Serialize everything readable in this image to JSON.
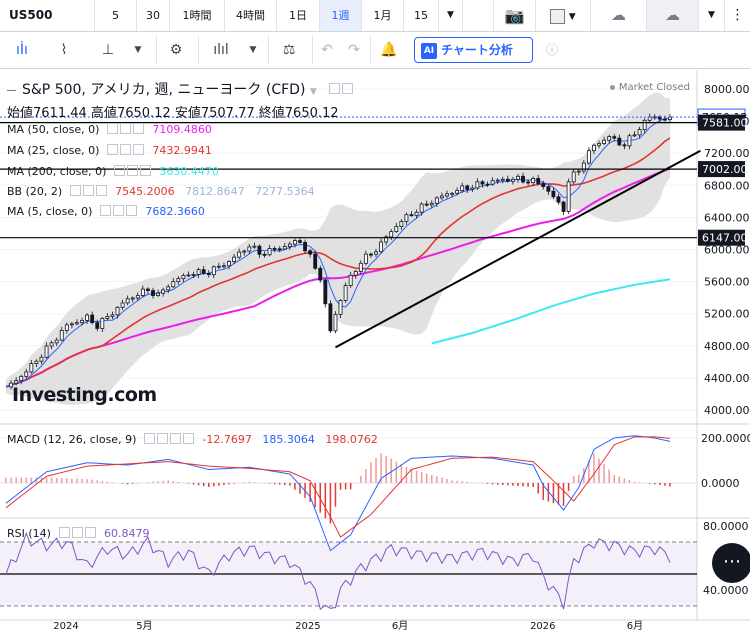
{
  "topbar": {
    "symbol": "US500",
    "intervals": [
      "5",
      "30",
      "1時間",
      "4時間",
      "1日",
      "1週",
      "1月",
      "15"
    ],
    "active_interval": "1週"
  },
  "toolbar2": {
    "ai_label": "チャート分析",
    "ai_badge": "AI"
  },
  "legend": {
    "title": "S&P 500, アメリカ, 週, ニューヨーク (CFD)",
    "market_status": "Market Closed",
    "open_label": "始値",
    "open": "7611.44",
    "high_label": "高値",
    "high": "7650.12",
    "low_label": "安値",
    "low": "7507.77",
    "close_label": "終値",
    "close": "7650.12",
    "ma50": {
      "label": "MA (50, close, 0)",
      "value": "7109.4860",
      "color": "#e91ee9"
    },
    "ma25": {
      "label": "MA (25, close, 0)",
      "value": "7432.9941",
      "color": "#e3352f"
    },
    "ma200": {
      "label": "MA (200, close, 0)",
      "value": "5630.4470",
      "color": "#3ee8ee"
    },
    "bb": {
      "label": "BB (20, 2)",
      "mid": "7545.2006",
      "upper": "7812.8647",
      "lower": "7277.5364"
    },
    "ma5": {
      "label": "MA (5, close, 0)",
      "value": "7682.3660",
      "color": "#2962ff"
    }
  },
  "macd_legend": {
    "label": "MACD (12, 26, close, 9)",
    "hist": "-12.7697",
    "macd": "185.3064",
    "signal": "198.0762"
  },
  "rsi_legend": {
    "label": "RSI (14)",
    "value": "60.8479"
  },
  "watermark": "Investing.com",
  "chart_data": [
    {
      "type": "candlestick",
      "title": "S&P 500, アメリカ, 週, ニューヨーク (CFD)",
      "x_ticks": [
        "2024",
        "5月",
        "2025",
        "6月",
        "2026",
        "6月"
      ],
      "ylim": [
        4000,
        8000
      ],
      "y_ticks": [
        4000,
        4400,
        4800,
        5200,
        5600,
        6000,
        6400,
        6800,
        7200,
        7600,
        8000
      ],
      "price_labels": [
        "7650.12",
        "7581.00",
        "7002.00",
        "6147.00"
      ],
      "horizontal_lines": [
        7581,
        7002,
        6147
      ],
      "close_path": [
        [
          0,
          4270
        ],
        [
          4,
          4480
        ],
        [
          8,
          4760
        ],
        [
          12,
          5050
        ],
        [
          16,
          5150
        ],
        [
          18,
          5050
        ],
        [
          20,
          5160
        ],
        [
          24,
          5380
        ],
        [
          28,
          5500
        ],
        [
          30,
          5420
        ],
        [
          32,
          5560
        ],
        [
          36,
          5700
        ],
        [
          40,
          5720
        ],
        [
          44,
          5850
        ],
        [
          48,
          6050
        ],
        [
          50,
          5950
        ],
        [
          54,
          6020
        ],
        [
          58,
          6110
        ],
        [
          60,
          5900
        ],
        [
          62,
          5650
        ],
        [
          63,
          5300
        ],
        [
          64,
          4980
        ],
        [
          65,
          5200
        ],
        [
          67,
          5550
        ],
        [
          70,
          5850
        ],
        [
          73,
          6000
        ],
        [
          77,
          6300
        ],
        [
          80,
          6450
        ],
        [
          84,
          6600
        ],
        [
          88,
          6720
        ],
        [
          92,
          6790
        ],
        [
          96,
          6850
        ],
        [
          100,
          6880
        ],
        [
          104,
          6850
        ],
        [
          106,
          6800
        ],
        [
          108,
          6650
        ],
        [
          110,
          6500
        ],
        [
          111,
          6850
        ],
        [
          113,
          7000
        ],
        [
          116,
          7300
        ],
        [
          119,
          7400
        ],
        [
          122,
          7300
        ],
        [
          124,
          7450
        ],
        [
          127,
          7650
        ],
        [
          128,
          7660
        ],
        [
          130,
          7612
        ],
        [
          131,
          7650
        ]
      ],
      "trendline": [
        [
          65,
          4780
        ],
        [
          137,
          7230
        ]
      ],
      "ma200_path": [
        [
          84,
          4830
        ],
        [
          92,
          4960
        ],
        [
          100,
          5120
        ],
        [
          108,
          5300
        ],
        [
          116,
          5450
        ],
        [
          124,
          5560
        ],
        [
          131,
          5630
        ]
      ]
    },
    {
      "type": "line",
      "title": "MACD (12, 26, close, 9)",
      "ylim": [
        -300,
        300
      ],
      "y_ticks": [
        0,
        200
      ],
      "series": [
        {
          "name": "MACD",
          "values": [
            [
              0,
              -90
            ],
            [
              8,
              50
            ],
            [
              16,
              90
            ],
            [
              24,
              80
            ],
            [
              32,
              105
            ],
            [
              40,
              60
            ],
            [
              48,
              70
            ],
            [
              56,
              40
            ],
            [
              60,
              -60
            ],
            [
              64,
              -300
            ],
            [
              68,
              -230
            ],
            [
              74,
              20
            ],
            [
              80,
              110
            ],
            [
              88,
              120
            ],
            [
              96,
              110
            ],
            [
              104,
              80
            ],
            [
              106,
              -10
            ],
            [
              110,
              -120
            ],
            [
              113,
              -20
            ],
            [
              116,
              150
            ],
            [
              120,
              200
            ],
            [
              124,
              210
            ],
            [
              128,
              200
            ],
            [
              131,
              185
            ]
          ]
        },
        {
          "name": "signal",
          "values": [
            [
              0,
              -110
            ],
            [
              8,
              30
            ],
            [
              16,
              75
            ],
            [
              24,
              85
            ],
            [
              32,
              95
            ],
            [
              40,
              75
            ],
            [
              48,
              65
            ],
            [
              56,
              50
            ],
            [
              60,
              10
            ],
            [
              64,
              -150
            ],
            [
              66,
              -240
            ],
            [
              72,
              -140
            ],
            [
              80,
              60
            ],
            [
              88,
              110
            ],
            [
              96,
              115
            ],
            [
              104,
              95
            ],
            [
              108,
              10
            ],
            [
              112,
              -80
            ],
            [
              116,
              40
            ],
            [
              120,
              170
            ],
            [
              124,
              205
            ],
            [
              128,
              205
            ],
            [
              131,
              198
            ]
          ]
        }
      ]
    },
    {
      "type": "line",
      "title": "RSI (14)",
      "ylim": [
        20,
        80
      ],
      "y_ticks": [
        40,
        80
      ],
      "series": [
        {
          "name": "RSI",
          "values": [
            [
              0,
              50
            ],
            [
              4,
              72
            ],
            [
              8,
              68
            ],
            [
              12,
              70
            ],
            [
              16,
              55
            ],
            [
              20,
              66
            ],
            [
              24,
              62
            ],
            [
              28,
              70
            ],
            [
              32,
              58
            ],
            [
              36,
              64
            ],
            [
              40,
              50
            ],
            [
              44,
              62
            ],
            [
              48,
              66
            ],
            [
              52,
              61
            ],
            [
              56,
              58
            ],
            [
              60,
              44
            ],
            [
              62,
              32
            ],
            [
              64,
              26
            ],
            [
              66,
              40
            ],
            [
              70,
              54
            ],
            [
              76,
              66
            ],
            [
              82,
              62
            ],
            [
              88,
              60
            ],
            [
              94,
              64
            ],
            [
              100,
              58
            ],
            [
              104,
              62
            ],
            [
              106,
              48
            ],
            [
              108,
              40
            ],
            [
              110,
              32
            ],
            [
              112,
              58
            ],
            [
              116,
              70
            ],
            [
              120,
              68
            ],
            [
              124,
              64
            ],
            [
              128,
              66
            ],
            [
              131,
              61
            ]
          ]
        }
      ]
    }
  ]
}
